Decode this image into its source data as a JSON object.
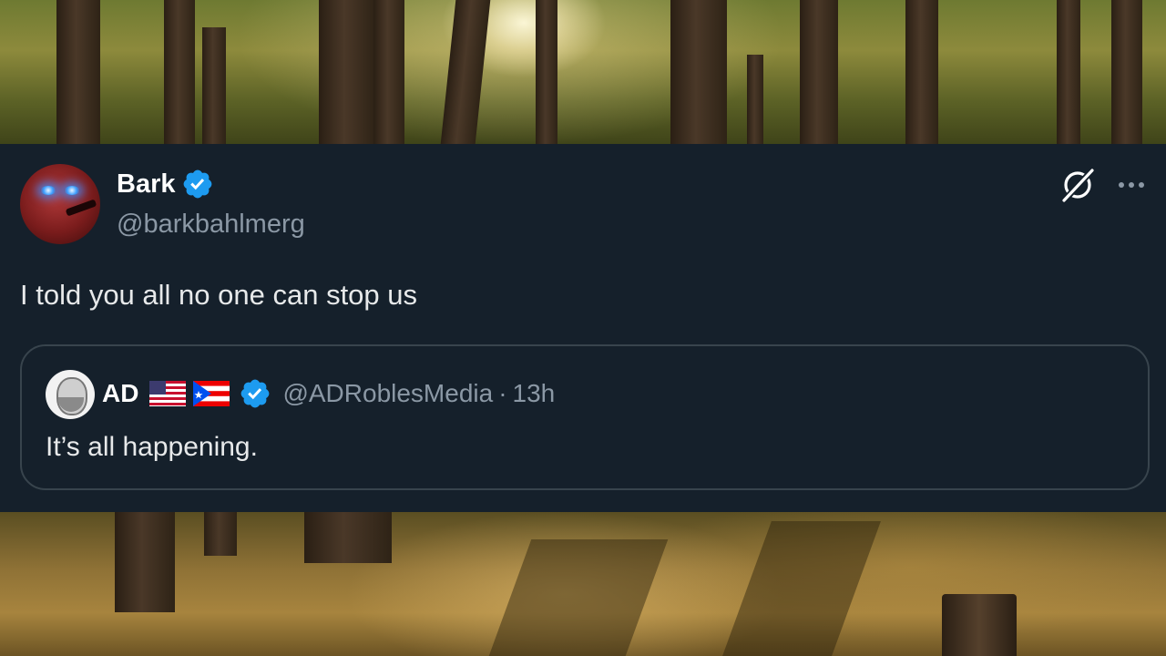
{
  "tweet": {
    "author": {
      "display_name": "Bark",
      "handle": "@barkbahlmerg",
      "verified": true,
      "avatar_icon": "red-glowing-eyes-avatar-icon"
    },
    "text": "I told you all no one can stop us",
    "actions": {
      "grok_icon": "grok-icon",
      "more_icon": "more-options-icon"
    },
    "quote": {
      "author": {
        "display_name": "AD",
        "flags": [
          "us-flag-icon",
          "puerto-rico-flag-icon"
        ],
        "verified": true,
        "handle": "@ADRoblesMedia",
        "separator": "·",
        "time": "13h"
      },
      "text": "It’s all happening."
    }
  },
  "colors": {
    "card_background": "#15202b",
    "verified_blue": "#1d9bf0",
    "secondary_text": "#8b98a5",
    "border": "#38444d"
  }
}
